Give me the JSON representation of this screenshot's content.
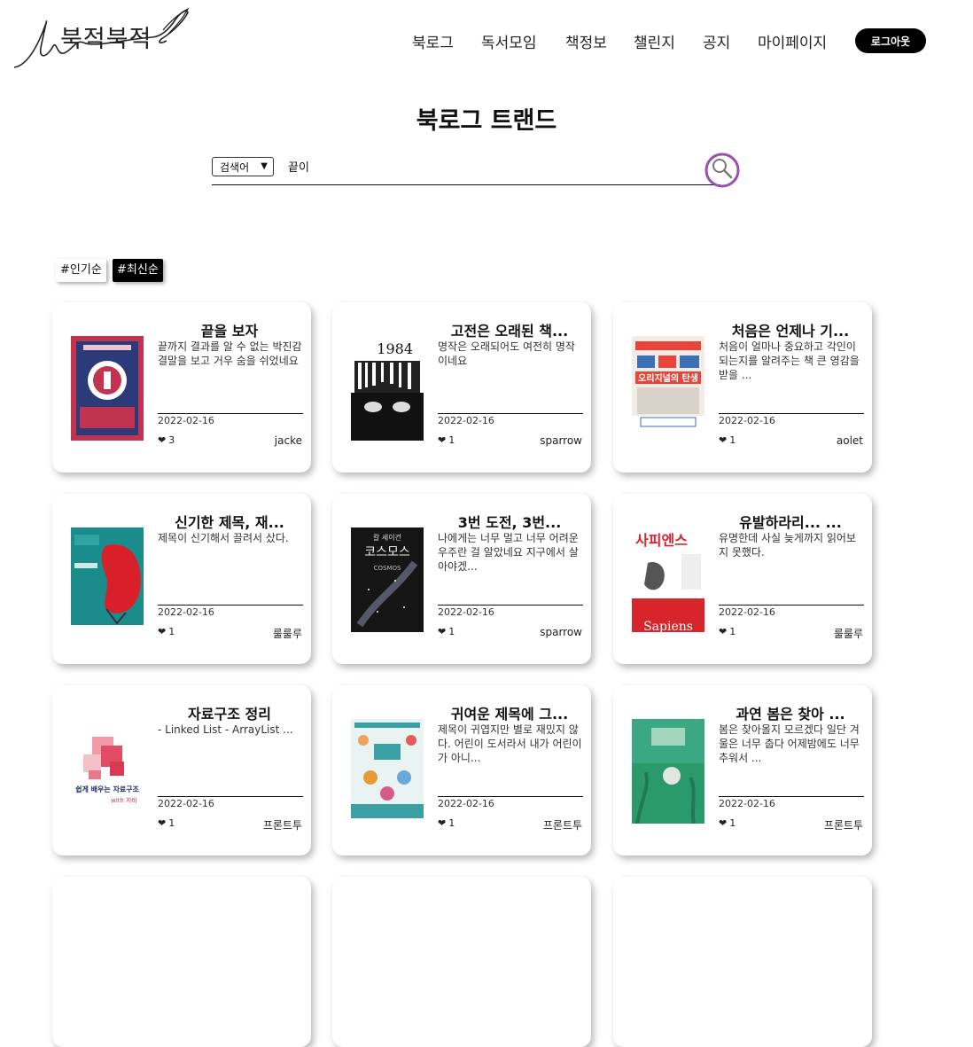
{
  "header": {
    "logo_text": "북적북적",
    "nav": [
      "북로그",
      "독서모임",
      "책정보",
      "챌린지",
      "공지",
      "마이페이지"
    ],
    "logout_label": "로그아웃"
  },
  "page_title": "북로그 트랜드",
  "search": {
    "select_value": "검색어",
    "query": "끝이"
  },
  "sort": {
    "popular_label": "#인기순",
    "latest_label": "#최신순",
    "active": "latest"
  },
  "cards": [
    {
      "title": "끝을 보자",
      "summary": "끝까지 결과를 알 수 없는 박진감 결말을 보고 거우 숨을 쉬었네요",
      "date": "2022-02-16",
      "likes": "3",
      "author": "jacke",
      "cover_color": "#c2334f"
    },
    {
      "title": "고전은 오래된 책...",
      "summary": "명작은 오래되어도 여전히 명작이네요",
      "date": "2022-02-16",
      "likes": "1",
      "author": "sparrow",
      "cover_color": "#ffffff"
    },
    {
      "title": "처음은 언제나 기...",
      "summary": "처음이 얼마나 중요하고 각인이 되는지를 알려주는 책 큰 영감을 받을 ...",
      "date": "2022-02-16",
      "likes": "1",
      "author": "aolet",
      "cover_color": "#e8443a"
    },
    {
      "title": "신기한 제목, 재...",
      "summary": "제목이 신기해서 끌려서 샀다.",
      "date": "2022-02-16",
      "likes": "1",
      "author": "룰룰루",
      "cover_color": "#1b8c8c"
    },
    {
      "title": "3번 도전, 3번...",
      "summary": "나에게는 너무 멀고 너무 어려운 우주란 걸 알았네요 지구에서 살아야겠...",
      "date": "2022-02-16",
      "likes": "1",
      "author": "sparrow",
      "cover_color": "#151515"
    },
    {
      "title": "유발하라리... ...",
      "summary": "유명한데 사실 늦게까지 읽어보지 못했다.",
      "date": "2022-02-16",
      "likes": "1",
      "author": "룰룰루",
      "cover_color": "#ffffff"
    },
    {
      "title": "자료구조 정리",
      "summary": "- Linked List - ArrayList ...",
      "date": "2022-02-16",
      "likes": "1",
      "author": "프론트투",
      "cover_color": "#ffffff"
    },
    {
      "title": "귀여운 제목에 그...",
      "summary": "제목이 귀엽지만 별로 재밌지 않다. 어린이 도서라서 내가 어린이가 아니...",
      "date": "2022-02-16",
      "likes": "1",
      "author": "프론트투",
      "cover_color": "#3aa0a3"
    },
    {
      "title": "과연 봄은 찾아 ...",
      "summary": "봄은 찾아올지 모르겠다 일단 겨울은 너무 춥다 어제밤에도 너무 추워서 ...",
      "date": "2022-02-16",
      "likes": "1",
      "author": "프론트투",
      "cover_color": "#2a9a6a"
    }
  ],
  "cover_texts": {
    "c1984": "1984",
    "cosmos_author": "칼 세이건",
    "cosmos_title": "코스모스",
    "cosmos_en": "COSMOS",
    "sapiens_ko": "사피엔스",
    "sapiens_en": "Sapiens",
    "origin_title": "오리지널의 탄생",
    "ds_title": "쉽게 배우는 자료구조",
    "ds_sub": "with 자바"
  },
  "colors": {
    "accent": "#000000",
    "search_ring": "#9b4fb0"
  }
}
